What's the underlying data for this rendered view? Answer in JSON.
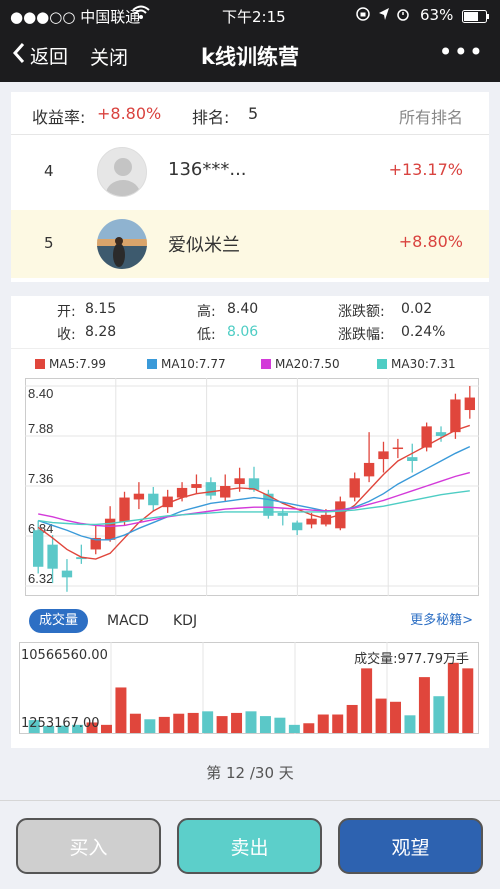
{
  "status": {
    "carrier": "●●●○○ 中国联通",
    "time": "下午2:15",
    "battery": "63%"
  },
  "nav": {
    "back": "返回",
    "close": "关闭",
    "title": "k线训练营",
    "more": "•••"
  },
  "rank": {
    "yield_label": "收益率:",
    "yield_value": "+8.80%",
    "rank_label": "排名:",
    "rank_value": "5",
    "all_link": "所有排名",
    "rows": [
      {
        "pos": "4",
        "name": "136***...",
        "pct": "+13.17%"
      },
      {
        "pos": "5",
        "name": "爱似米兰",
        "pct": "+8.80%"
      }
    ]
  },
  "ohlc": {
    "open_label": "开:",
    "open": "8.15",
    "high_label": "高:",
    "high": "8.40",
    "chg_label": "涨跌额:",
    "chg": "0.02",
    "close_label": "收:",
    "close": "8.28",
    "low_label": "低:",
    "low": "8.06",
    "pct_label": "涨跌幅:",
    "pct": "0.24%"
  },
  "legend": [
    {
      "text": "MA5:7.99",
      "color": "#e0463c"
    },
    {
      "text": "MA10:7.77",
      "color": "#3a9ad9"
    },
    {
      "text": "MA20:7.50",
      "color": "#d33ad9"
    },
    {
      "text": "MA30:7.31",
      "color": "#4ecdc4"
    }
  ],
  "tabs": {
    "active": "成交量",
    "t2": "MACD",
    "t3": "KDJ",
    "more": "更多秘籍>"
  },
  "volume": {
    "max_label": "10566560.00",
    "min_label": "1253167.00",
    "current": "成交量:977.79万手"
  },
  "footer": {
    "day": "第 12 /30 天"
  },
  "buttons": {
    "buy": "买入",
    "sell": "卖出",
    "watch": "观望"
  },
  "colors": {
    "up": "#e0463c",
    "down": "#5bc8c8",
    "nav": "#1c1c1e",
    "sell_btn": "#5ccfca",
    "watch_btn": "#2d62b0"
  },
  "chart_data": {
    "type": "candlestick",
    "y_ticks": [
      "8.40",
      "7.88",
      "7.36",
      "6.84",
      "6.32"
    ],
    "ylim": [
      6.32,
      8.4
    ],
    "candles": [
      {
        "o": 6.9,
        "c": 6.52,
        "h": 7.0,
        "l": 6.45
      },
      {
        "o": 6.75,
        "c": 6.5,
        "h": 6.85,
        "l": 6.35
      },
      {
        "o": 6.48,
        "c": 6.41,
        "h": 6.6,
        "l": 6.26
      },
      {
        "o": 6.62,
        "c": 6.6,
        "h": 6.75,
        "l": 6.55
      },
      {
        "o": 6.7,
        "c": 6.82,
        "h": 6.95,
        "l": 6.65
      },
      {
        "o": 6.8,
        "c": 7.02,
        "h": 7.15,
        "l": 6.78
      },
      {
        "o": 6.99,
        "c": 7.24,
        "h": 7.3,
        "l": 6.95
      },
      {
        "o": 7.22,
        "c": 7.28,
        "h": 7.4,
        "l": 7.12
      },
      {
        "o": 7.28,
        "c": 7.16,
        "h": 7.35,
        "l": 7.1
      },
      {
        "o": 7.14,
        "c": 7.25,
        "h": 7.32,
        "l": 7.08
      },
      {
        "o": 7.24,
        "c": 7.34,
        "h": 7.4,
        "l": 7.2
      },
      {
        "o": 7.34,
        "c": 7.38,
        "h": 7.48,
        "l": 7.28
      },
      {
        "o": 7.4,
        "c": 7.26,
        "h": 7.45,
        "l": 7.22
      },
      {
        "o": 7.24,
        "c": 7.36,
        "h": 7.48,
        "l": 7.2
      },
      {
        "o": 7.38,
        "c": 7.44,
        "h": 7.55,
        "l": 7.3
      },
      {
        "o": 7.44,
        "c": 7.32,
        "h": 7.56,
        "l": 7.3
      },
      {
        "o": 7.28,
        "c": 7.05,
        "h": 7.32,
        "l": 7.02
      },
      {
        "o": 7.08,
        "c": 7.05,
        "h": 7.12,
        "l": 6.95
      },
      {
        "o": 6.98,
        "c": 6.9,
        "h": 7.0,
        "l": 6.85
      },
      {
        "o": 6.96,
        "c": 7.02,
        "h": 7.08,
        "l": 6.92
      },
      {
        "o": 6.96,
        "c": 7.06,
        "h": 7.12,
        "l": 6.94
      },
      {
        "o": 6.92,
        "c": 7.2,
        "h": 7.25,
        "l": 6.9
      },
      {
        "o": 7.24,
        "c": 7.44,
        "h": 7.5,
        "l": 7.2
      },
      {
        "o": 7.46,
        "c": 7.6,
        "h": 7.92,
        "l": 7.4
      },
      {
        "o": 7.64,
        "c": 7.72,
        "h": 7.82,
        "l": 7.5
      },
      {
        "o": 7.76,
        "c": 7.76,
        "h": 7.85,
        "l": 7.65
      },
      {
        "o": 7.66,
        "c": 7.62,
        "h": 7.8,
        "l": 7.5
      },
      {
        "o": 7.76,
        "c": 7.98,
        "h": 8.02,
        "l": 7.72
      },
      {
        "o": 7.92,
        "c": 7.88,
        "h": 7.98,
        "l": 7.82
      },
      {
        "o": 7.92,
        "c": 8.26,
        "h": 8.32,
        "l": 7.85
      },
      {
        "o": 8.15,
        "c": 8.28,
        "h": 8.4,
        "l": 8.06
      }
    ],
    "ma5": [
      6.93,
      6.82,
      6.7,
      6.62,
      6.6,
      6.66,
      6.82,
      6.98,
      7.1,
      7.18,
      7.24,
      7.28,
      7.3,
      7.32,
      7.34,
      7.33,
      7.26,
      7.18,
      7.12,
      7.06,
      7.02,
      7.06,
      7.16,
      7.32,
      7.48,
      7.62,
      7.7,
      7.78,
      7.86,
      7.94,
      7.99
    ],
    "ma10": [
      7.0,
      6.95,
      6.9,
      6.84,
      6.8,
      6.8,
      6.85,
      6.92,
      6.98,
      7.04,
      7.1,
      7.14,
      7.18,
      7.2,
      7.22,
      7.24,
      7.22,
      7.19,
      7.16,
      7.13,
      7.1,
      7.11,
      7.14,
      7.2,
      7.28,
      7.38,
      7.46,
      7.54,
      7.62,
      7.7,
      7.77
    ],
    "ma20": [
      7.07,
      7.04,
      7.0,
      6.97,
      6.95,
      6.94,
      6.95,
      6.98,
      7.01,
      7.04,
      7.06,
      7.08,
      7.1,
      7.12,
      7.13,
      7.14,
      7.14,
      7.13,
      7.12,
      7.11,
      7.1,
      7.11,
      7.13,
      7.17,
      7.21,
      7.26,
      7.31,
      7.36,
      7.41,
      7.46,
      7.5
    ],
    "ma30": [
      7.0,
      6.98,
      6.97,
      6.96,
      6.96,
      6.97,
      6.99,
      7.01,
      7.03,
      7.05,
      7.06,
      7.07,
      7.08,
      7.09,
      7.09,
      7.09,
      7.09,
      7.09,
      7.09,
      7.09,
      7.09,
      7.1,
      7.11,
      7.13,
      7.15,
      7.18,
      7.21,
      7.24,
      7.27,
      7.29,
      7.31
    ],
    "volume_ylim": [
      1253167,
      10566560
    ],
    "volume": [
      2500000,
      1400000,
      1800000,
      1900000,
      2200000,
      1900000,
      6600000,
      3300000,
      2600000,
      2900000,
      3300000,
      3400000,
      3600000,
      3000000,
      3400000,
      3600000,
      3000000,
      2800000,
      1900000,
      2100000,
      3200000,
      3200000,
      4400000,
      9000000,
      5200000,
      4800000,
      3100000,
      7900000,
      5500000,
      9700000,
      9000000
    ]
  }
}
